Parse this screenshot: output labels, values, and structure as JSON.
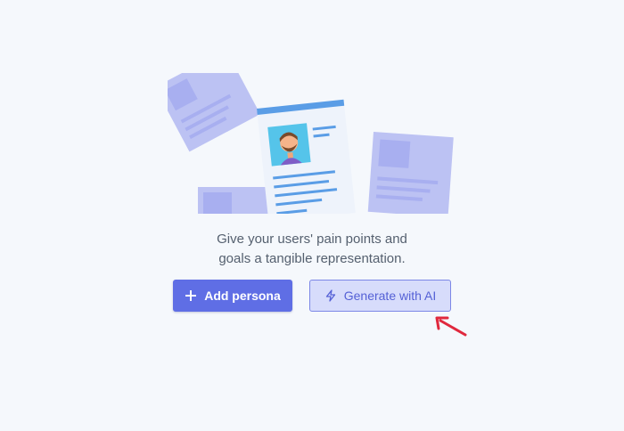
{
  "empty_state": {
    "illustration": "persona-cards-illustration",
    "description_line1": "Give your users' pain points and",
    "description_line2": "goals a tangible representation."
  },
  "actions": {
    "add_persona_label": "Add persona",
    "add_persona_icon": "plus-icon",
    "generate_ai_label": "Generate with AI",
    "generate_ai_icon": "lightning-bolt-icon"
  },
  "annotation": {
    "type": "arrow",
    "color": "#e0283d"
  },
  "colors": {
    "background": "#f5f8fc",
    "primary": "#5f6ee5",
    "secondary_bg": "#d7dcfb",
    "secondary_text": "#5561d6",
    "card_fill": "#bcc2f3",
    "card_accent": "#a8aff0",
    "document_lines": "#5a9de6",
    "text_muted": "#55606f"
  }
}
